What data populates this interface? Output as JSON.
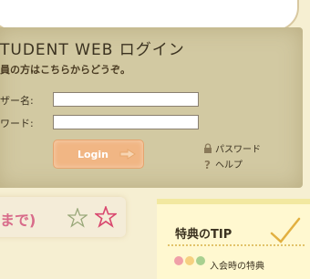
{
  "top_card": {
    "text": "…"
  },
  "login": {
    "title": "TUDENT WEB ログイン",
    "subtitle": "員の方はこちらからどうぞ。",
    "username_label": "ザー名:",
    "password_label": "ワード:",
    "username_value": "",
    "password_value": "",
    "login_button": "Login",
    "password_link": "パスワード",
    "help_link": "ヘルプ"
  },
  "banner": {
    "text": "まで)"
  },
  "tip": {
    "title": "特典のTIP",
    "item": "入会時の特典"
  },
  "colors": {
    "panel": "#d2c9a2",
    "button": "#f1b684",
    "banner_text": "#d86b8a",
    "tip_bg": "#fff8d0"
  },
  "icons": [
    "arrow-icon",
    "lock-icon",
    "question-icon",
    "star-icon",
    "check-icon",
    "flower-icon"
  ]
}
